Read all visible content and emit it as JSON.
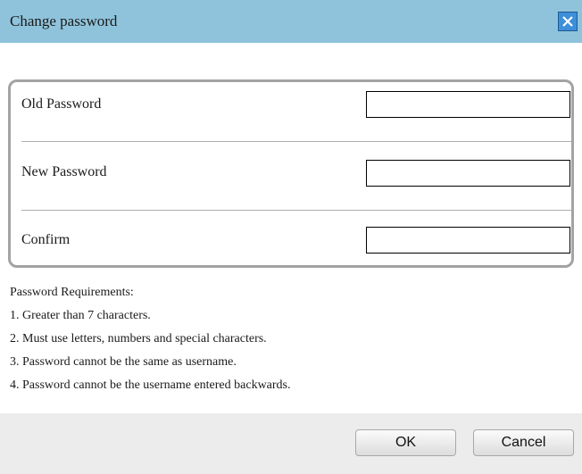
{
  "dialog": {
    "title": "Change password",
    "close_icon": "close-icon"
  },
  "form": {
    "rows": [
      {
        "label": "Old Password",
        "value": "",
        "placeholder": ""
      },
      {
        "label": "New Password",
        "value": "",
        "placeholder": ""
      },
      {
        "label": "Confirm",
        "value": "",
        "placeholder": ""
      }
    ]
  },
  "requirements": {
    "heading": "Password Requirements:",
    "items": [
      "1. Greater than 7 characters.",
      "2. Must use letters, numbers and special characters.",
      "3. Password cannot be the same as username.",
      "4. Password cannot be the username entered backwards."
    ]
  },
  "buttons": {
    "ok_label": "OK",
    "cancel_label": "Cancel"
  },
  "colors": {
    "titlebar": "#8fc3db",
    "close_button": "#3d8fd8",
    "footer": "#ececec"
  }
}
